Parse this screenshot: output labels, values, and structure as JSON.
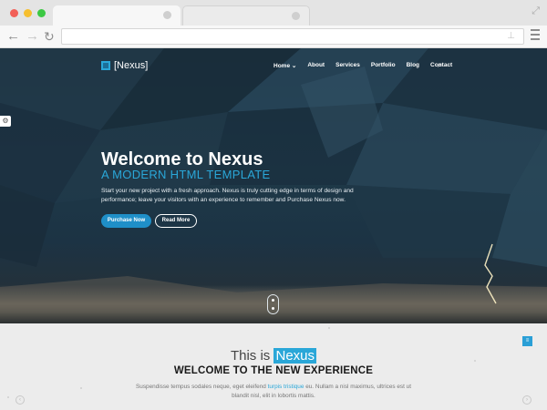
{
  "browser": {
    "expand_icon": "expand-icon",
    "back_icon": "←",
    "forward_icon": "→",
    "reload_icon": "↻"
  },
  "site": {
    "brand": "[Nexus]",
    "nav": [
      "Home",
      "About",
      "Services",
      "Portfolio",
      "Blog",
      "Contact"
    ],
    "home_caret": "⌄",
    "search_icon": "⌕",
    "accent": "#2aa7d8"
  },
  "hero": {
    "title": "Welcome to Nexus",
    "subtitle": "A MODERN HTML TEMPLATE",
    "description": "Start your new project with a fresh approach. Nexus is truly cutting edge in terms of design and performance; leave your visitors with an experience to remember and Purchase Nexus now.",
    "primary_button": "Purchase Now",
    "secondary_button": "Read More"
  },
  "intro": {
    "this_is": "This is",
    "highlight": "Nexus",
    "heading": "WELCOME TO THE NEW EXPERIENCE",
    "text_before": "Suspendisse tempus sodales neque, eget eleifend",
    "link": "turpis tristique",
    "text_after": "eu. Nullam a nisl maximus, ultrices est ut blandit nisl, elit in lobortis mattis.",
    "left_arrow": "‹",
    "right_arrow": "›"
  }
}
